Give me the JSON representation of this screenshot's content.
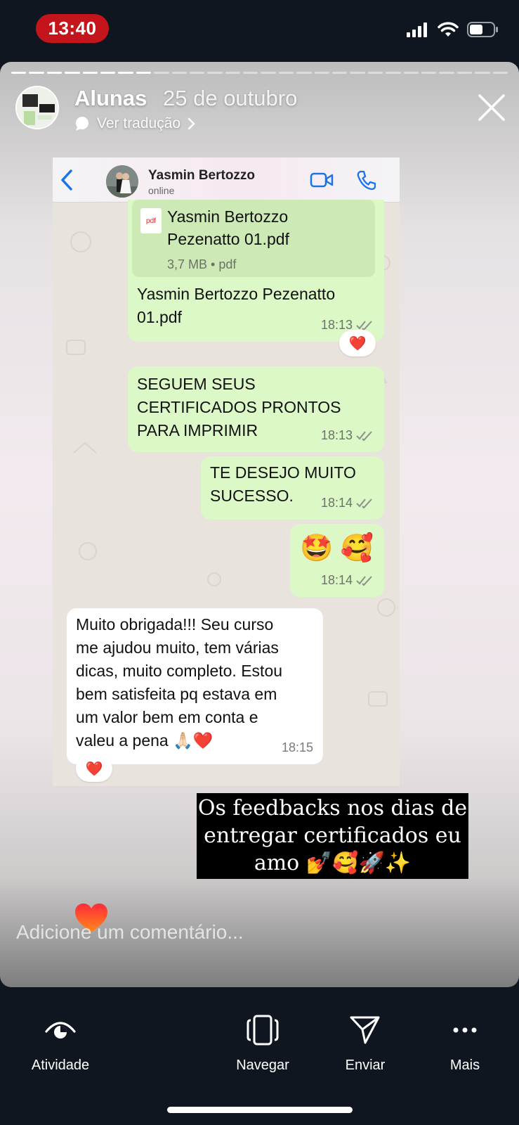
{
  "status_bar": {
    "time": "13:40",
    "signal_icon": "cellular-signal-icon",
    "wifi_icon": "wifi-icon",
    "battery_icon": "battery-icon"
  },
  "story": {
    "progress_segments": 28,
    "segments_viewed": 8,
    "username": "Alunas",
    "date": "25 de outubro",
    "translate_label": "Ver tradução",
    "close_icon": "close-icon"
  },
  "whatsapp": {
    "contact_name": "Yasmin Bertozzo",
    "contact_status": "online",
    "messages": [
      {
        "direction": "out",
        "file_name": "Yasmin Bertozzo\nPezenatto 01.pdf",
        "file_info": "3,7 MB • pdf",
        "file_badge": "pdf",
        "text": "Yasmin Bertozzo Pezenatto\n01.pdf",
        "time": "18:13",
        "reaction": "❤️"
      },
      {
        "direction": "out",
        "text": "SEGUEM SEUS\nCERTIFICADOS PRONTOS\nPARA IMPRIMIR",
        "time": "18:13"
      },
      {
        "direction": "out",
        "text": "TE DESEJO MUITO\nSUCESSO.",
        "time": "18:14"
      },
      {
        "direction": "out",
        "text": "🤩 🥰",
        "time": "18:14"
      },
      {
        "direction": "in",
        "text": "Muito obrigada!!! Seu curso\nme ajudou muito, tem várias\ndicas, muito completo. Estou\nbem satisfeita pq estava em\num valor bem em conta e\nvaleu a pena 🙏🏻❤️",
        "time": "18:15",
        "reaction": "❤️"
      }
    ]
  },
  "caption": "Os feedbacks nos dias de\nentregar certificados eu\namo 💅🥰🚀✨",
  "comment_placeholder": "Adicione um comentário...",
  "toolbar": [
    {
      "label": "Atividade",
      "icon": "activity-eye-icon"
    },
    {
      "label": "Navegar",
      "icon": "browse-icon"
    },
    {
      "label": "Enviar",
      "icon": "send-icon"
    },
    {
      "label": "Mais",
      "icon": "more-icon"
    }
  ]
}
